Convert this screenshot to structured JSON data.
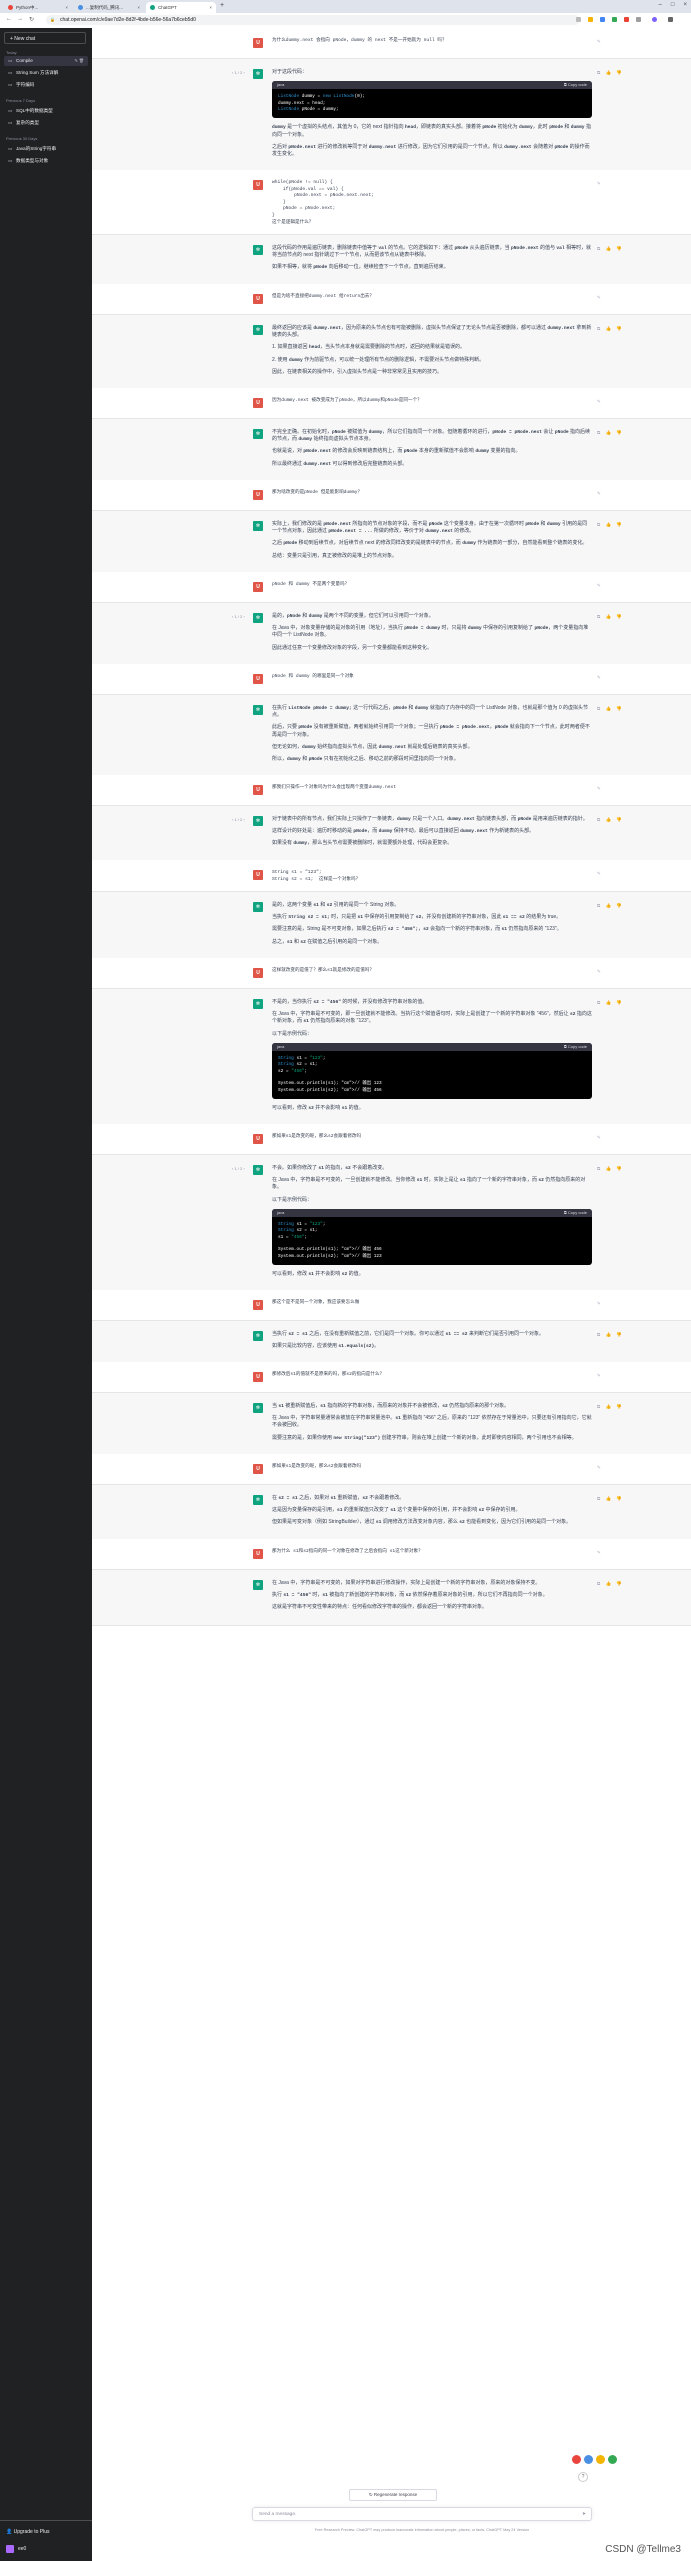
{
  "browser": {
    "tabs": [
      {
        "label": "Python中...",
        "color": "#e8453c"
      },
      {
        "label": "...复制代码_腾讯...",
        "color": "#4a90e2"
      },
      {
        "label": "ChatGPT",
        "color": "#10a37f"
      }
    ],
    "url": "chat.openai.com/c/e9ae7d2e-8d2f-4bde-b56e-56a7b6ceb5d0"
  },
  "sidebar": {
    "new_chat": "+  New chat",
    "sections": [
      "Today",
      "Previous 7 Days",
      "Previous 30 Days"
    ],
    "items": [
      "Compile",
      "String Sum 方法详解",
      "字符编码",
      "SQL中的数据类型",
      "复杂的类型",
      "Java的String字符串",
      "数据类型与对象"
    ],
    "upgrade": "Upgrade to Plus",
    "user": "ee0"
  },
  "conversation": [
    {
      "role": "user",
      "text": "为什么dummy.next 会指向 pNode，dummy 的 next 不是一开始就为 null 吗？"
    },
    {
      "role": "assistant",
      "page": "1 / 2",
      "paras": [
        "对于这段代码：",
        "CODE:ListNode dummy = new ListNode(0);|dummy.next = head;|ListNode pNode = dummy;",
        "`dummy` 是一个虚拟的头结点，其值为 0，它的 next 指针指向 `head`，即链表的真实头部。接着将 `pNode` 初始化为 `dummy`，此时 `pNode` 和 `dummy` 指向同一个对象。",
        "之后对 `pNode.next` 进行的修改就等同于对 `dummy.next` 进行修改，因为它们引用的是同一个节点。所以 `dummy.next` 会随着对 `pNode` 的操作而发生变化。"
      ]
    },
    {
      "role": "user",
      "text": "while(pNode != null) {\n    if(pNode.val == val) {\n        pNode.next = pNode.next.next;\n    }\n    pNode = pNode.next;\n}\n这个是逻辑是什么？"
    },
    {
      "role": "assistant",
      "paras": [
        "这段代码的作用是遍历链表，删除链表中值等于 `val` 的节点。它的逻辑如下：通过 `pNode` 从头遍历链表，当 `pNode.next` 的值与 `val` 相等时，就将当前节点的 next 指针跳过下一个节点，从而把该节点从链表中移除。",
        "如果不相等，就将 `pNode` 向后移动一位，继续检查下一个节点，直到遍历结束。"
      ]
    },
    {
      "role": "user",
      "text": "但是为啥不直接把dummy.next 给return出去？"
    },
    {
      "role": "assistant",
      "paras": [
        "最终返回的应该是 `dummy.next`，因为原来的头节点也有可能被删除，虚拟头节点保证了无论头节点是否被删除，都可以通过 `dummy.next` 拿到新链表的头部。",
        "1. 如果直接返回 `head`，当头节点本身就是需要删除的节点时，返回的结果就是错误的。",
        "2. 使用 `dummy` 作为前驱节点，可以统一处理所有节点的删除逻辑，不需要对头节点做特殊判断。",
        "因此，在链表相关的操作中，引入虚拟头节点是一种非常常见且实用的技巧。"
      ]
    },
    {
      "role": "user",
      "text": "因为dummy.next 被改变成为了pNode，所以dummy和pNode是同一个？"
    },
    {
      "role": "assistant",
      "paras": [
        "不完全正确。在初始化时，`pNode` 被赋值为 `dummy`，所以它们指向同一个对象。但随着循环的进行，`pNode = pNode.next` 会让 `pNode` 指向后续的节点，而 `dummy` 始终指向虚拟头节点本身。",
        "也就是说，对 `pNode.next` 的修改会反映到链表结构上，而 `pNode` 本身的重新赋值不会影响 `dummy` 变量的指向。",
        "所以最终通过 `dummy.next` 可以得到修改后完整链表的头部。"
      ]
    },
    {
      "role": "user",
      "text": "那为啥改变的是pNode 但是能影响dummy？"
    },
    {
      "role": "assistant",
      "paras": [
        "实际上，我们修改的是 `pNode.next` 所指向的节点对象的字段，而不是 `pNode` 这个变量本身。由于在第一次循环时 `pNode` 和 `dummy` 引用的是同一个节点对象，因此通过 `pNode.next = ...` 所做的修改，等价于对 `dummy.next` 的修改。",
        "之后 `pNode` 移动到后续节点，对后续节点 next 的修改同样改变的是链表中的节点，而 `dummy` 作为链表的一部分，自然能看到整个链表的变化。",
        "总结：变量只是引用，真正被修改的是堆上的节点对象。"
      ]
    },
    {
      "role": "user",
      "text": "pNode 和 dummy 不是两个变量吗？"
    },
    {
      "role": "assistant",
      "page": "1 / 2",
      "paras": [
        "是的，`pNode` 和 `dummy` 是两个不同的变量，但它们可以引用同一个对象。",
        "在 Java 中，对象变量存储的是对象的引用（地址），当执行 `pNode = dummy` 时，只是将 `dummy` 中保存的引用复制给了 `pNode`，两个变量指向堆中同一个 ListNode 对象。",
        "因此通过任意一个变量修改对象的字段，另一个变量都能看到这种变化。"
      ]
    },
    {
      "role": "user",
      "text": "pNode 和 dummy 的哪里是同一个对象"
    },
    {
      "role": "assistant",
      "paras": [
        "在执行 `ListNode pNode = dummy;` 这一行代码之后，`pNode` 和 `dummy` 就指向了内存中的同一个 ListNode 对象，也就是那个值为 0 的虚拟头节点。",
        "此后，只要 `pNode` 没有被重新赋值，两者就始终引用同一个对象；一旦执行 `pNode = pNode.next`，`pNode` 就会指向下一个节点，此时两者便不再是同一个对象。",
        "但无论如何，`dummy` 始终指向虚拟头节点，因此 `dummy.next` 就是处理后链表的真实头部。",
        "所以，`dummy` 和 `pNode` 只有在初始化之后、移动之前的那段时间里指向同一个对象。"
      ]
    },
    {
      "role": "user",
      "text": "那我们只操作一个对象吗为什么会出现两个变量dummy.next"
    },
    {
      "role": "assistant",
      "page": "1 / 2",
      "paras": [
        "对于链表中的所有节点，我们实际上只操作了一条链表，`dummy` 只是一个入口。`dummy.next` 指向链表头部，而 `pNode` 是用来遍历链表的指针。",
        "这样设计的好处是：遍历时移动的是 `pNode`，而 `dummy` 保持不动，最后可以直接返回 `dummy.next` 作为新链表的头部。",
        "如果没有 `dummy`，那么当头节点需要被删除时，就需要额外处理，代码会更复杂。"
      ]
    },
    {
      "role": "user",
      "text": "String s1 = \"123\";\nString s2 = s1;  这样是一个对象吗？"
    },
    {
      "role": "assistant",
      "paras": [
        "是的，这两个变量 `s1` 和 `s2` 引用的是同一个 String 对象。",
        "当执行 `String s2 = s1;` 时，只是把 `s1` 中保存的引用复制给了 `s2`，并没有创建新的字符串对象，因此 `s1 == s2` 的结果为 true。",
        "需要注意的是，String 是不可变对象，如果之后执行 `s2 = \"456\";`，`s2` 会指向一个新的字符串对象，而 `s1` 仍然指向原来的 \"123\"。",
        "总之，`s1` 和 `s2` 在赋值之后引用的是同一个对象。"
      ]
    },
    {
      "role": "user",
      "text": "这样就改变的是值了？那么s1就是修改的是值吗？"
    },
    {
      "role": "assistant",
      "paras": [
        "不是的，当你执行 `s2 = \"456\"` 的时候，并没有修改字符串对象的值。",
        "在 Java 中，字符串是不可变的，即一旦创建就不能修改。当执行这个赋值语句时，实际上是创建了一个新的字符串对象 \"456\"，然后让 `s2` 指向这个新对象，而 `s1` 仍然指向原来的对象 \"123\"。",
        "以下是示例代码：",
        "CODE:String s1 = \"123\";|String s2 = s1;|s2 = \"456\";||System.out.println(s1); // 输出 123|System.out.println(s2); // 输出 456",
        "可以看到，修改 `s2` 并不会影响 `s1` 的值。"
      ]
    },
    {
      "role": "user",
      "text": "那如果s1是改变的呢，那么s2会跟着修改吗"
    },
    {
      "role": "assistant",
      "page": "1 / 2",
      "paras": [
        "不会。如果你修改了 `s1` 的指向，`s2` 不会跟着改变。",
        "在 Java 中，字符串是不可变的，一旦创建就不能修改。当你修改 `s1` 时，实际上是让 `s1` 指向了一个新的字符串对象，而 `s2` 仍然指向原来的对象。",
        "以下是示例代码：",
        "CODE:String s1 = \"123\";|String s2 = s1;|s1 = \"456\";||System.out.println(s1); // 输出 456|System.out.println(s2); // 输出 123",
        "可以看到，修改 `s1` 并不会影响 `s2` 的值。"
      ]
    },
    {
      "role": "user",
      "text": "那这个是不是同一个对象，我应该要怎么做"
    },
    {
      "role": "assistant",
      "paras": [
        "当执行 `s2 = s1` 之后，在没有重新赋值之前，它们是同一个对象。你可以通过 `s1 == s2` 来判断它们是否引用同一个对象。",
        "如果只是比较内容，应该使用 `s1.equals(s2)`。"
      ]
    },
    {
      "role": "user",
      "text": "那修改后s1的值就不是原来的吗，那s2的指向是什么？"
    },
    {
      "role": "assistant",
      "paras": [
        "当 `s1` 被重新赋值后，`s1` 指向新的字符串对象，而原来的对象并不会被修改，`s2` 仍然指向原来的那个对象。",
        "在 Java 中，字符串常量通常会被放在字符串常量池中。`s1` 重新指向 \"456\" 之后，原来的 \"123\" 依然存在于常量池中，只要还有引用指向它，它就不会被回收。",
        "需要注意的是，如果你使用 `new String(\"123\")` 创建字符串，则会在堆上创建一个新的对象，此时即使内容相同，两个引用也不会相等。"
      ]
    },
    {
      "role": "user",
      "text": "那如果s1是改变的呢，那么s2会跟着修改吗"
    },
    {
      "role": "assistant",
      "paras": [
        "在 `s2 = s1` 之后，如果对 `s1` 重新赋值，`s2` 不会跟着修改。",
        "这是因为变量保存的是引用，`s1` 的重新赋值只改变了 `s1` 这个变量中保存的引用，并不会影响 `s2` 中保存的引用。",
        "但如果是可变对象（例如 StringBuilder），通过 `s1` 调用修改方法改变对象内容，那么 `s2` 也能看到变化，因为它们引用的是同一个对象。"
      ]
    },
    {
      "role": "user",
      "text": "那为什么 s1和s2指向的同一个对象在修改了之后会指向 s1这个新对象？"
    },
    {
      "role": "assistant",
      "paras": [
        "在 Java 中，字符串是不可变的，如果对字符串进行修改操作，实际上是创建一个新的字符串对象，原来的对象保持不变。",
        "执行 `s1 = \"456\"` 时，`s1` 被指向了新创建的字符串对象，而 `s2` 依然保存着原来对象的引用，所以它们不再指向同一个对象。",
        "这就是字符串不可变性带来的特点：任何看似修改字符串的操作，都会返回一个新的字符串对象。"
      ]
    }
  ],
  "composer": {
    "regenerate": "↻  Regenerate response",
    "placeholder": "Send a message.",
    "footer": "Free Research Preview. ChatGPT may produce inaccurate information about people, places, or facts. ChatGPT May 24 Version"
  },
  "watermark": "CSDN @Tellme3"
}
